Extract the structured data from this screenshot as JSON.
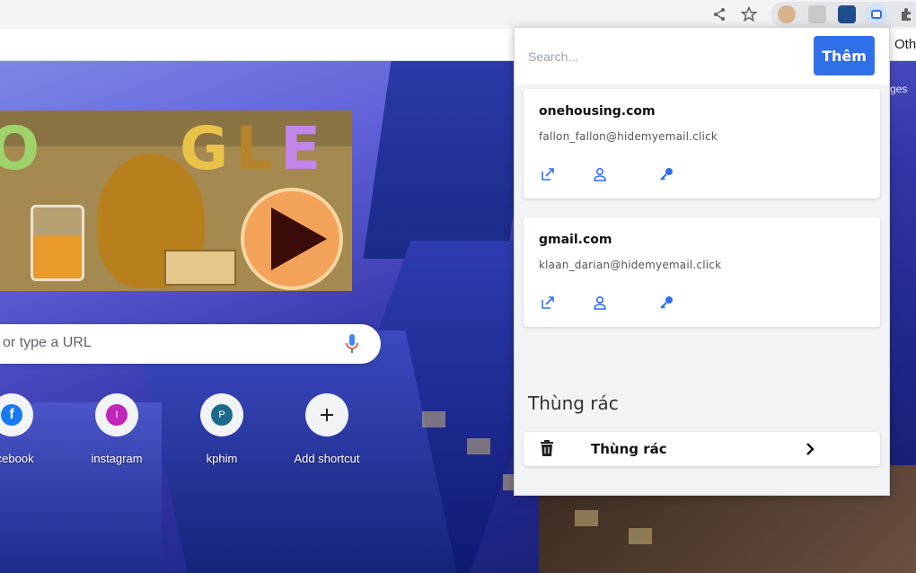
{
  "bookmarks": {
    "other_label": "Oth"
  },
  "ntp": {
    "search_placeholder": "or type a URL",
    "side_text": "ges",
    "shortcuts": [
      {
        "label": "acebook",
        "icon": "facebook-icon",
        "color": "#1877f2"
      },
      {
        "label": "instagram",
        "icon": "instagram-icon",
        "letter": "I",
        "color": "#c026b7"
      },
      {
        "label": "kphim",
        "icon": "kphim-icon",
        "letter": "P",
        "color": "#1e6a8a"
      },
      {
        "label": "Add shortcut",
        "icon": "plus-icon"
      }
    ],
    "doodle_letters": [
      "O",
      "G",
      "L",
      "E"
    ]
  },
  "popup": {
    "search_placeholder": "Search...",
    "add_label": "Thêm",
    "accent": "#2f6fe8",
    "accounts": [
      {
        "domain": "onehousing.com",
        "email": "fallon_fallon@hidemyemail.click"
      },
      {
        "domain": "gmail.com",
        "email": "klaan_darian@hidemyemail.click"
      }
    ],
    "trash_heading": "Thùng rác",
    "trash_label": "Thùng rác"
  }
}
